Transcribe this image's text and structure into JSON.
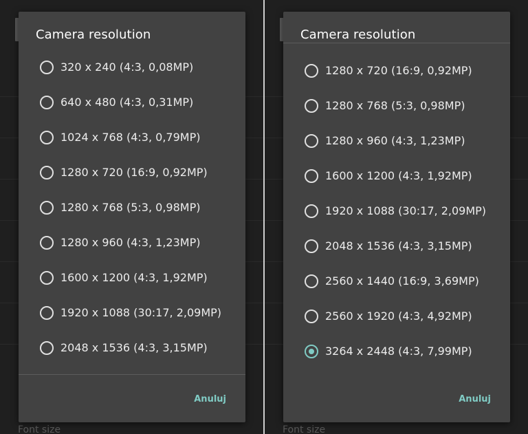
{
  "left_panel": {
    "dialog": {
      "title": "Camera resolution",
      "options": [
        {
          "label": "320 x 240 (4:3, 0,08MP)",
          "checked": false
        },
        {
          "label": "640 x 480 (4:3, 0,31MP)",
          "checked": false
        },
        {
          "label": "1024 x 768 (4:3, 0,79MP)",
          "checked": false
        },
        {
          "label": "1280 x 720 (16:9, 0,92MP)",
          "checked": false
        },
        {
          "label": "1280 x 768 (5:3, 0,98MP)",
          "checked": false
        },
        {
          "label": "1280 x 960 (4:3, 1,23MP)",
          "checked": false
        },
        {
          "label": "1600 x 1200 (4:3, 1,92MP)",
          "checked": false
        },
        {
          "label": "1920 x 1088 (30:17, 2,09MP)",
          "checked": false
        },
        {
          "label": "2048 x 1536 (4:3, 3,15MP)",
          "checked": false
        }
      ],
      "cancel_label": "Anuluj"
    },
    "background_footer": "Font size"
  },
  "right_panel": {
    "dialog": {
      "title": "Camera resolution",
      "options": [
        {
          "label": "1280 x 720 (16:9, 0,92MP)",
          "checked": false
        },
        {
          "label": "1280 x 768 (5:3, 0,98MP)",
          "checked": false
        },
        {
          "label": "1280 x 960 (4:3, 1,23MP)",
          "checked": false
        },
        {
          "label": "1600 x 1200 (4:3, 1,92MP)",
          "checked": false
        },
        {
          "label": "1920 x 1088 (30:17, 2,09MP)",
          "checked": false
        },
        {
          "label": "2048 x 1536 (4:3, 3,15MP)",
          "checked": false
        },
        {
          "label": "2560 x 1440 (16:9, 3,69MP)",
          "checked": false
        },
        {
          "label": "2560 x 1920 (4:3, 4,92MP)",
          "checked": false
        },
        {
          "label": "3264 x 2448 (4:3, 7,99MP)",
          "checked": true
        }
      ],
      "cancel_label": "Anuluj"
    },
    "background_footer": "Font size"
  },
  "colors": {
    "dialog_background": "#424242",
    "accent": "#80cbc4",
    "text": "#ececec"
  },
  "icons": {
    "radio_unchecked": "radio-unchecked-icon",
    "radio_checked": "radio-checked-icon"
  }
}
